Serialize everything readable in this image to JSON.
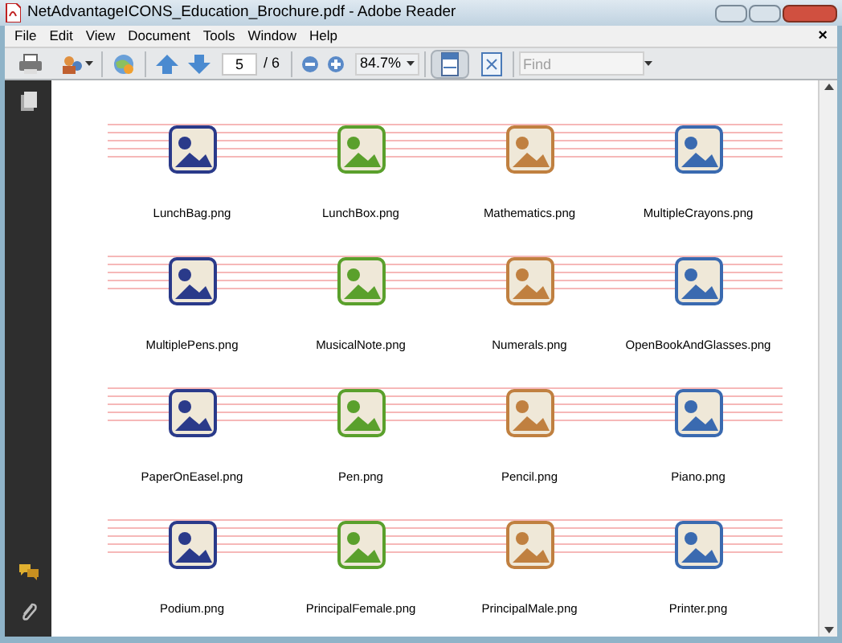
{
  "window": {
    "title": "NetAdvantageICONS_Education_Brochure.pdf - Adobe Reader"
  },
  "menu": {
    "items": [
      "File",
      "Edit",
      "View",
      "Document",
      "Tools",
      "Window",
      "Help"
    ],
    "close": "×"
  },
  "toolbar": {
    "page": {
      "value": "5",
      "total": "/ 6"
    },
    "zoom": "84.7%",
    "find": {
      "placeholder": "Find"
    }
  },
  "icons": [
    {
      "label": "LunchBag.png"
    },
    {
      "label": "LunchBox.png"
    },
    {
      "label": "Mathematics.png"
    },
    {
      "label": "MultipleCrayons.png"
    },
    {
      "label": "MultiplePens.png"
    },
    {
      "label": "MusicalNote.png"
    },
    {
      "label": "Numerals.png"
    },
    {
      "label": "OpenBookAndGlasses.png"
    },
    {
      "label": "PaperOnEasel.png"
    },
    {
      "label": "Pen.png"
    },
    {
      "label": "Pencil.png"
    },
    {
      "label": "Piano.png"
    },
    {
      "label": "Podium.png"
    },
    {
      "label": "PrincipalFemale.png"
    },
    {
      "label": "PrincipalMale.png"
    },
    {
      "label": "Printer.png"
    }
  ]
}
